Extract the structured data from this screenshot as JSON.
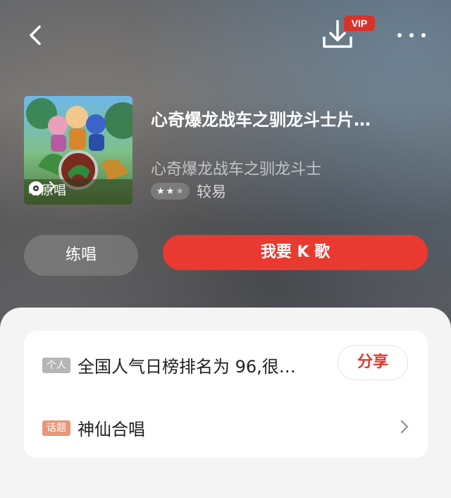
{
  "header": {
    "vip_badge": "VIP",
    "back_icon": "chevron-left-icon",
    "download_icon": "download-icon",
    "more_icon": "more-dots-icon"
  },
  "song": {
    "title": "心奇爆龙战车之驯龙斗士片…",
    "subtitle": "心奇爆龙战车之驯龙斗士",
    "difficulty_stars": 2,
    "difficulty_max": 3,
    "difficulty_label": "较易",
    "listen_label": "听原唱"
  },
  "actions": {
    "practice_label": "练唱",
    "ksing_label": "我要 K 歌"
  },
  "info_card": {
    "rank_tag": "个人",
    "rank_text": "全国人气日榜排名为 96,很…",
    "share_label": "分享",
    "topic_tag": "话题",
    "topic_text": "神仙合唱"
  },
  "colors": {
    "accent_red": "#e83a30",
    "tag_gray": "#b5b5b5",
    "tag_orange": "#e8967a"
  }
}
